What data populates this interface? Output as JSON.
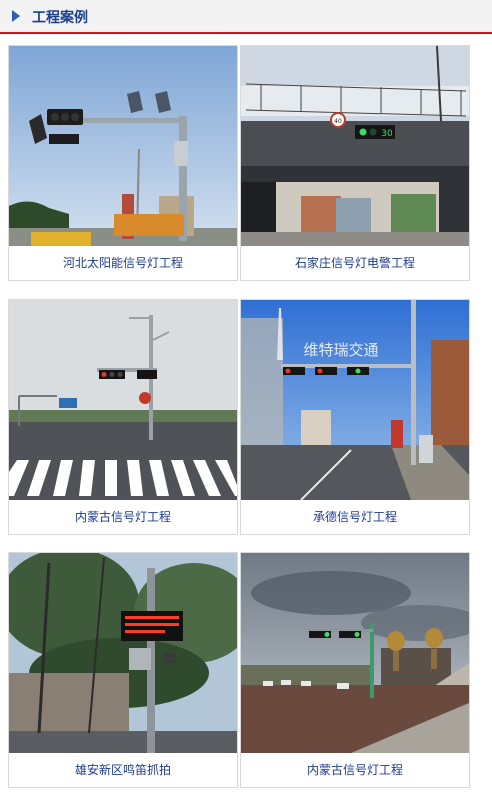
{
  "section": {
    "title": "工程案例"
  },
  "cases": [
    {
      "caption": "河北太阳能信号灯工程"
    },
    {
      "caption": "石家庄信号灯电警工程",
      "sign_text": "40",
      "countdown": "30"
    },
    {
      "caption": "内蒙古信号灯工程"
    },
    {
      "caption": "承德信号灯工程",
      "watermark": "维特瑞交通"
    },
    {
      "caption": "雄安新区鸣笛抓拍"
    },
    {
      "caption": "内蒙古信号灯工程"
    }
  ]
}
